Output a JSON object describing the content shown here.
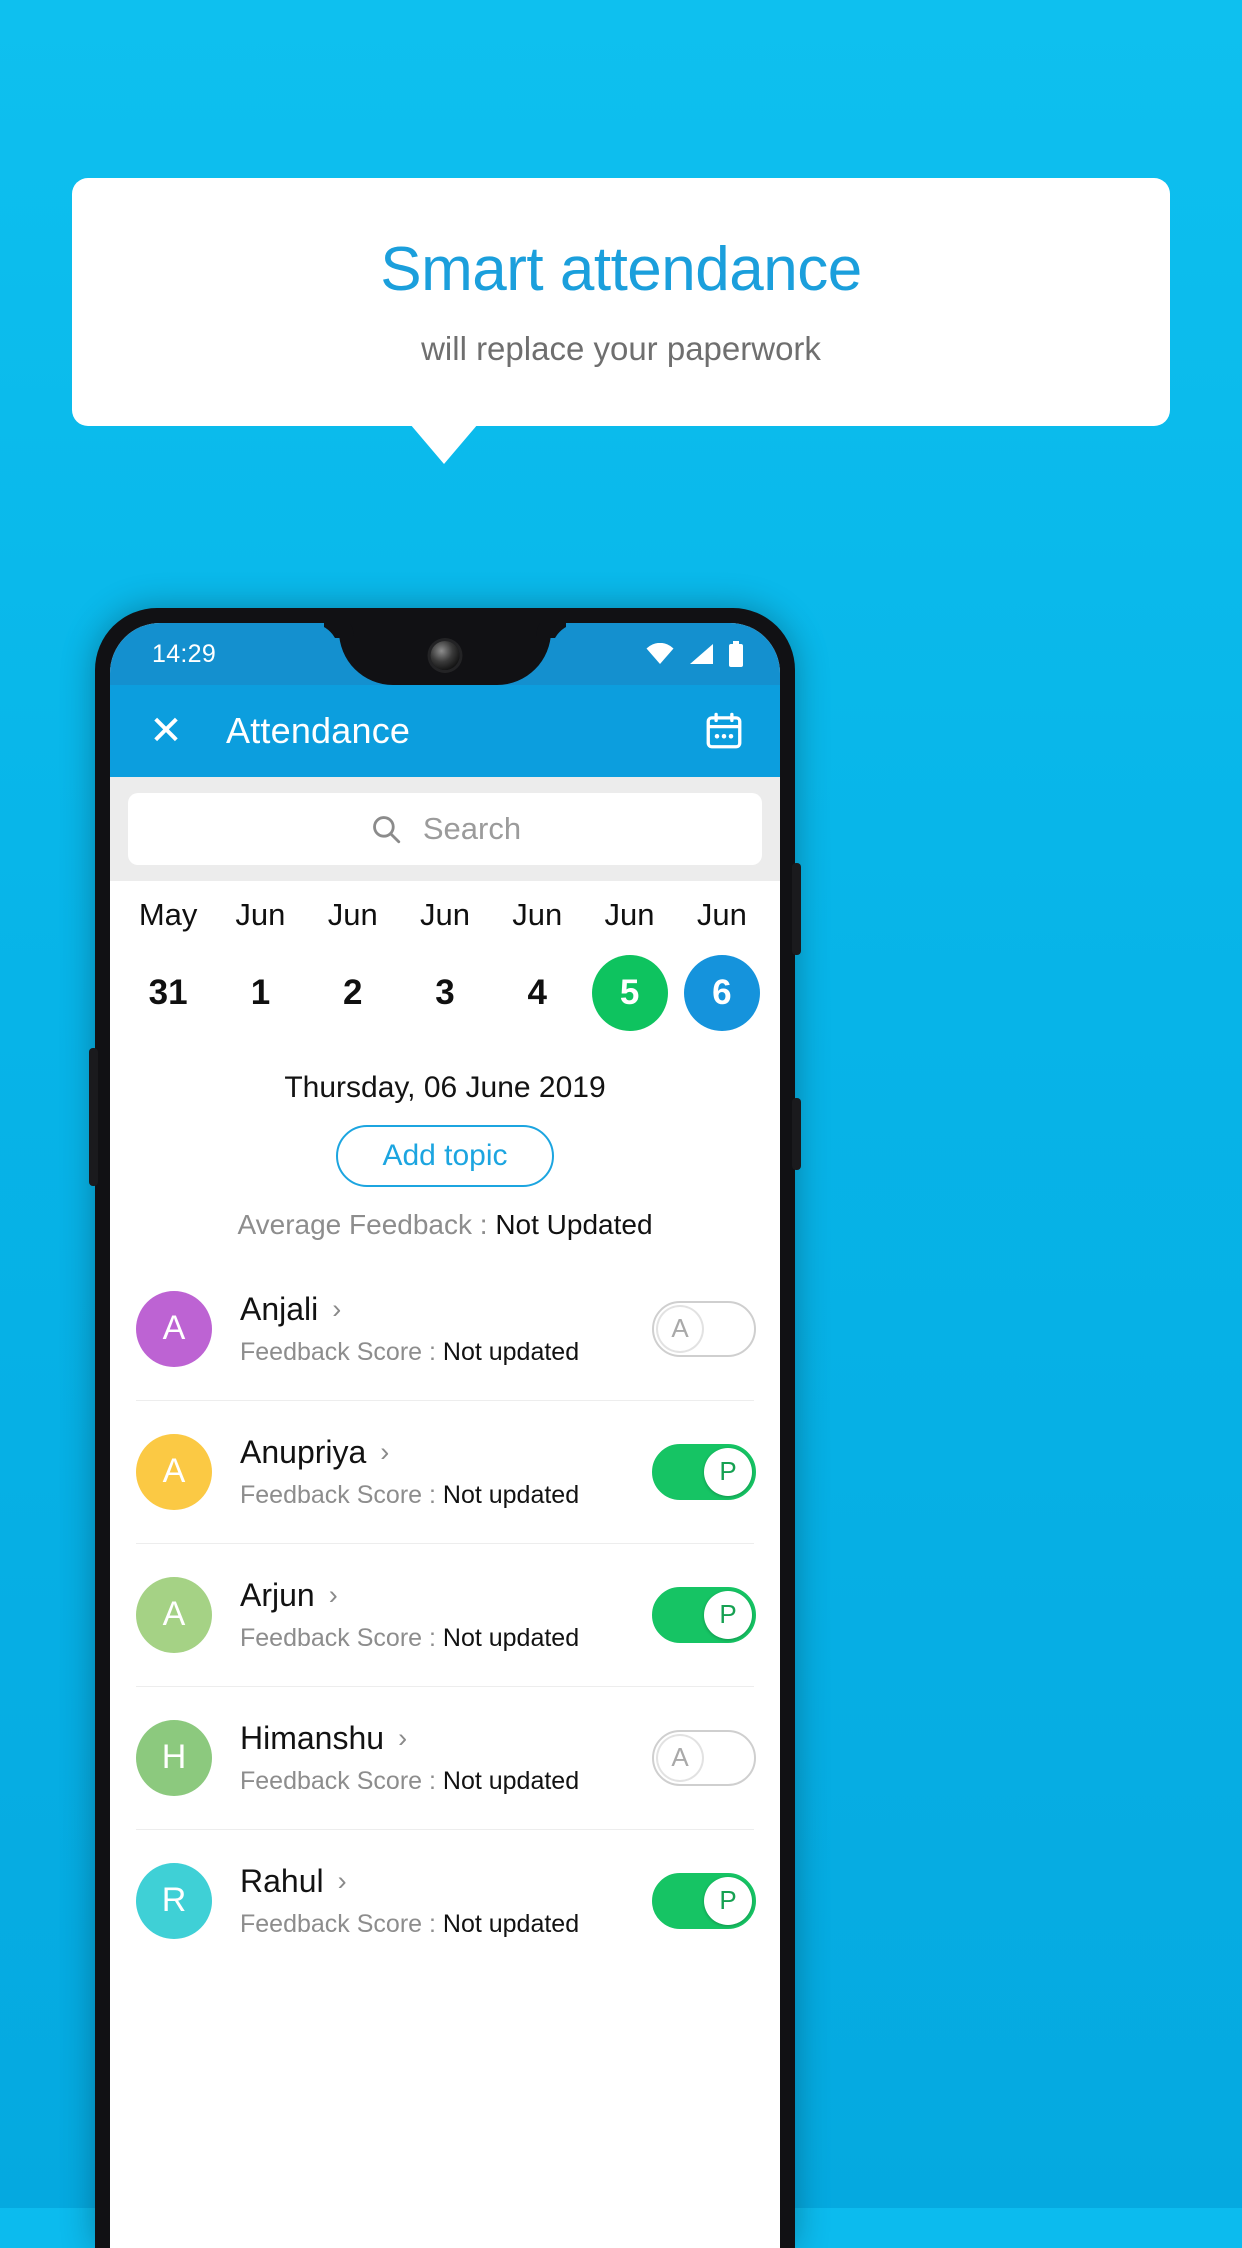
{
  "promo": {
    "title": "Smart attendance",
    "subtitle": "will replace your paperwork",
    "bg_color": "#0cbbee",
    "title_color": "#1b9fdc",
    "subtitle_color": "#6f6f6f"
  },
  "phone": {
    "status_bar": {
      "time": "14:29",
      "icons": [
        "wifi-icon",
        "signal-icon",
        "battery-icon"
      ],
      "bg_color": "#1490cf"
    },
    "app_bar": {
      "close_icon": "close-icon",
      "title": "Attendance",
      "calendar_icon": "calendar-icon",
      "bg_color": "#0c9ede"
    },
    "search": {
      "icon": "search-icon",
      "placeholder": "Search",
      "value": ""
    },
    "date_strip": [
      {
        "month": "May",
        "day": "31",
        "state": "normal"
      },
      {
        "month": "Jun",
        "day": "1",
        "state": "normal"
      },
      {
        "month": "Jun",
        "day": "2",
        "state": "normal"
      },
      {
        "month": "Jun",
        "day": "3",
        "state": "normal"
      },
      {
        "month": "Jun",
        "day": "4",
        "state": "normal"
      },
      {
        "month": "Jun",
        "day": "5",
        "state": "green"
      },
      {
        "month": "Jun",
        "day": "6",
        "state": "blue"
      }
    ],
    "day_heading": "Thursday, 06 June 2019",
    "add_topic_label": "Add topic",
    "average_feedback": {
      "label": "Average Feedback : ",
      "value": "Not Updated"
    },
    "students": [
      {
        "initial": "A",
        "name": "Anjali",
        "avatar_color": "#bd63d3",
        "score_label": "Feedback Score : ",
        "score_value": "Not updated",
        "attendance": "A",
        "attendance_state": "absent"
      },
      {
        "initial": "A",
        "name": "Anupriya",
        "avatar_color": "#fbc944",
        "score_label": "Feedback Score : ",
        "score_value": "Not updated",
        "attendance": "P",
        "attendance_state": "present"
      },
      {
        "initial": "A",
        "name": "Arjun",
        "avatar_color": "#a5d285",
        "score_label": "Feedback Score : ",
        "score_value": "Not updated",
        "attendance": "P",
        "attendance_state": "present"
      },
      {
        "initial": "H",
        "name": "Himanshu",
        "avatar_color": "#8cc97e",
        "score_label": "Feedback Score : ",
        "score_value": "Not updated",
        "attendance": "A",
        "attendance_state": "absent"
      },
      {
        "initial": "R",
        "name": "Rahul",
        "avatar_color": "#3fd0d6",
        "score_label": "Feedback Score : ",
        "score_value": "Not updated",
        "attendance": "P",
        "attendance_state": "present"
      }
    ],
    "chevron": "›"
  }
}
